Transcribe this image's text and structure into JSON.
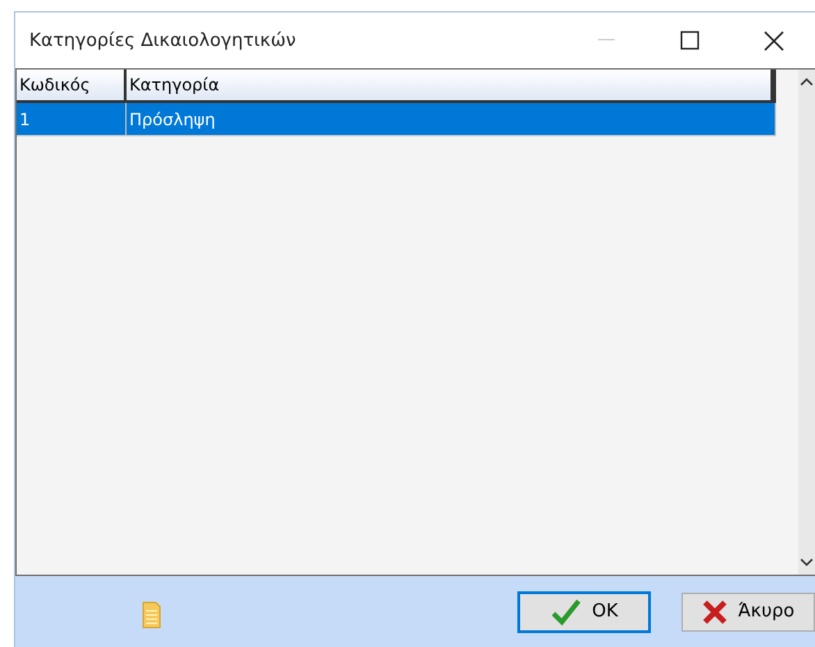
{
  "window": {
    "title": "Κατηγορίες Δικαιολογητικών"
  },
  "table": {
    "columns": [
      "Κωδικός",
      "Κατηγορία"
    ],
    "rows": [
      {
        "cells": [
          "1",
          "Πρόσληψη"
        ],
        "selected": true
      }
    ]
  },
  "buttons": [
    {
      "kind": "ok",
      "label": "OK",
      "default": true
    },
    {
      "kind": "cancel",
      "label": "Άκυρο",
      "default": false
    }
  ]
}
